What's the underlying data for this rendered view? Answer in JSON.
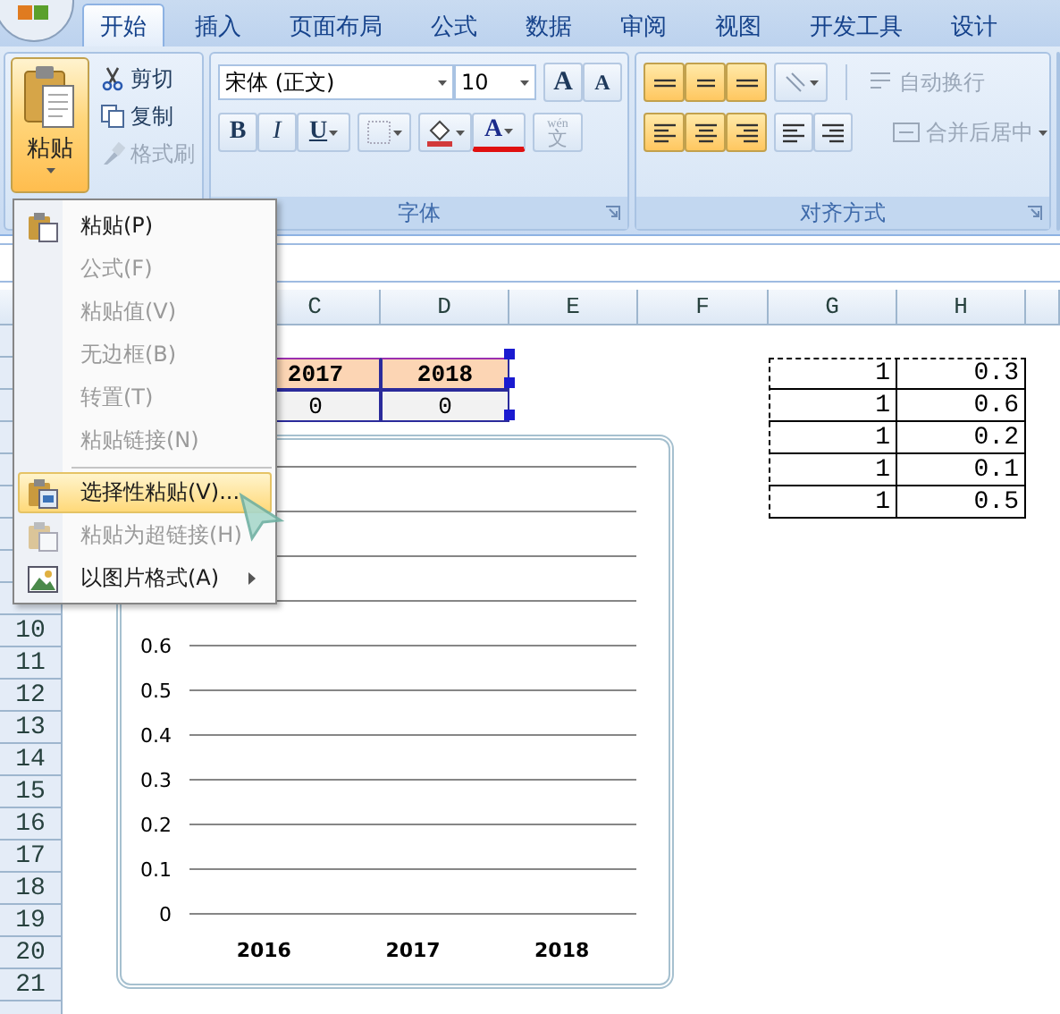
{
  "tabs": [
    {
      "label": "开始",
      "selected": true
    },
    {
      "label": "插入",
      "selected": false
    },
    {
      "label": "页面布局",
      "selected": false
    },
    {
      "label": "公式",
      "selected": false
    },
    {
      "label": "数据",
      "selected": false
    },
    {
      "label": "审阅",
      "selected": false
    },
    {
      "label": "视图",
      "selected": false
    },
    {
      "label": "开发工具",
      "selected": false
    },
    {
      "label": "设计",
      "selected": false
    }
  ],
  "clipboard": {
    "paste": {
      "label": "粘贴",
      "selected": true
    },
    "actions": [
      {
        "kind": "cut",
        "label": "剪切",
        "disabled": false
      },
      {
        "kind": "copy",
        "label": "复制",
        "disabled": false
      },
      {
        "kind": "brush",
        "label": "格式刷",
        "disabled": true
      }
    ]
  },
  "font_group": {
    "label": "字体",
    "font_name": "宋体 (正文)",
    "font_size": "10",
    "grow": "A",
    "shrink": "A",
    "bold": "B",
    "italic": "I",
    "underline": "U",
    "font_color": "A",
    "phonetic": "文",
    "phonetic_hint": "wén"
  },
  "align_group": {
    "label": "对齐方式",
    "vertical": [
      {
        "kind": "top",
        "selected": true
      },
      {
        "kind": "middle",
        "selected": true
      },
      {
        "kind": "bottom",
        "selected": true
      }
    ],
    "horizontal": [
      {
        "kind": "left",
        "selected": true
      },
      {
        "kind": "center",
        "selected": true
      },
      {
        "kind": "right",
        "selected": true
      }
    ],
    "wrap": "自动换行",
    "merge": "合并后居中"
  },
  "sheet": {
    "columns": [
      "C",
      "D",
      "E",
      "F",
      "G",
      "H"
    ],
    "row_numbers": [
      "10",
      "11",
      "12",
      "13",
      "14",
      "15",
      "16",
      "17",
      "18",
      "19",
      "20",
      "21"
    ],
    "year_header": [
      "2017",
      "2018"
    ],
    "year_values": [
      "0",
      "0"
    ],
    "copied": [
      [
        "1",
        "0.3"
      ],
      [
        "1",
        "0.6"
      ],
      [
        "1",
        "0.2"
      ],
      [
        "1",
        "0.1"
      ],
      [
        "1",
        "0.5"
      ]
    ]
  },
  "chart": {
    "chart_data": {
      "type": "line",
      "grid": true,
      "categories": [
        "2016",
        "2017",
        "2018"
      ],
      "ylim": [
        0,
        1
      ],
      "yticks": [
        0,
        0.1,
        0.2,
        0.3,
        0.4,
        0.5,
        0.6
      ]
    }
  },
  "paste_menu": {
    "groups": [
      {
        "items": [
          {
            "kind": "paste",
            "label": "粘贴(P)",
            "disabled": false,
            "selected": false,
            "submenu": false
          },
          {
            "kind": "none",
            "label": "公式(F)",
            "disabled": true,
            "selected": false,
            "submenu": false
          },
          {
            "kind": "none",
            "label": "粘贴值(V)",
            "disabled": true,
            "selected": false,
            "submenu": false
          },
          {
            "kind": "none",
            "label": "无边框(B)",
            "disabled": true,
            "selected": false,
            "submenu": false
          },
          {
            "kind": "none",
            "label": "转置(T)",
            "disabled": true,
            "selected": false,
            "submenu": false
          },
          {
            "kind": "none",
            "label": "粘贴链接(N)",
            "disabled": true,
            "selected": false,
            "submenu": false
          }
        ]
      },
      {
        "items": [
          {
            "kind": "special",
            "label": "选择性粘贴(V)...",
            "disabled": false,
            "selected": true,
            "submenu": false
          },
          {
            "kind": "link",
            "label": "粘贴为超链接(H)",
            "disabled": true,
            "selected": false,
            "submenu": false
          },
          {
            "kind": "picture",
            "label": "以图片格式(A)",
            "disabled": false,
            "selected": false,
            "submenu": true
          }
        ]
      }
    ]
  }
}
